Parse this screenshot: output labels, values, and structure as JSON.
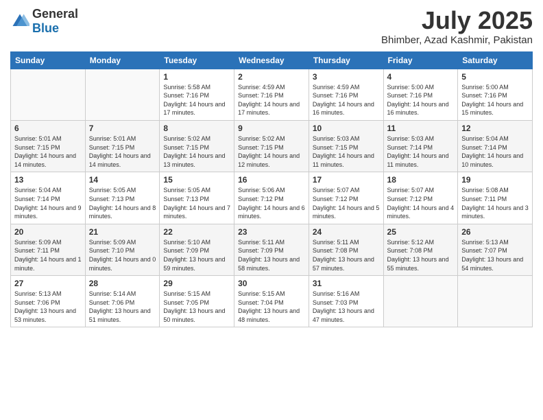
{
  "logo": {
    "general": "General",
    "blue": "Blue"
  },
  "header": {
    "month": "July 2025",
    "location": "Bhimber, Azad Kashmir, Pakistan"
  },
  "weekdays": [
    "Sunday",
    "Monday",
    "Tuesday",
    "Wednesday",
    "Thursday",
    "Friday",
    "Saturday"
  ],
  "weeks": [
    [
      {
        "day": null
      },
      {
        "day": null
      },
      {
        "day": 1,
        "sunrise": "5:58 AM",
        "sunset": "7:16 PM",
        "daylight": "14 hours and 17 minutes."
      },
      {
        "day": 2,
        "sunrise": "4:59 AM",
        "sunset": "7:16 PM",
        "daylight": "14 hours and 17 minutes."
      },
      {
        "day": 3,
        "sunrise": "4:59 AM",
        "sunset": "7:16 PM",
        "daylight": "14 hours and 16 minutes."
      },
      {
        "day": 4,
        "sunrise": "5:00 AM",
        "sunset": "7:16 PM",
        "daylight": "14 hours and 16 minutes."
      },
      {
        "day": 5,
        "sunrise": "5:00 AM",
        "sunset": "7:16 PM",
        "daylight": "14 hours and 15 minutes."
      }
    ],
    [
      {
        "day": 6,
        "sunrise": "5:01 AM",
        "sunset": "7:15 PM",
        "daylight": "14 hours and 14 minutes."
      },
      {
        "day": 7,
        "sunrise": "5:01 AM",
        "sunset": "7:15 PM",
        "daylight": "14 hours and 14 minutes."
      },
      {
        "day": 8,
        "sunrise": "5:02 AM",
        "sunset": "7:15 PM",
        "daylight": "14 hours and 13 minutes."
      },
      {
        "day": 9,
        "sunrise": "5:02 AM",
        "sunset": "7:15 PM",
        "daylight": "14 hours and 12 minutes."
      },
      {
        "day": 10,
        "sunrise": "5:03 AM",
        "sunset": "7:15 PM",
        "daylight": "14 hours and 11 minutes."
      },
      {
        "day": 11,
        "sunrise": "5:03 AM",
        "sunset": "7:14 PM",
        "daylight": "14 hours and 11 minutes."
      },
      {
        "day": 12,
        "sunrise": "5:04 AM",
        "sunset": "7:14 PM",
        "daylight": "14 hours and 10 minutes."
      }
    ],
    [
      {
        "day": 13,
        "sunrise": "5:04 AM",
        "sunset": "7:14 PM",
        "daylight": "14 hours and 9 minutes."
      },
      {
        "day": 14,
        "sunrise": "5:05 AM",
        "sunset": "7:13 PM",
        "daylight": "14 hours and 8 minutes."
      },
      {
        "day": 15,
        "sunrise": "5:05 AM",
        "sunset": "7:13 PM",
        "daylight": "14 hours and 7 minutes."
      },
      {
        "day": 16,
        "sunrise": "5:06 AM",
        "sunset": "7:12 PM",
        "daylight": "14 hours and 6 minutes."
      },
      {
        "day": 17,
        "sunrise": "5:07 AM",
        "sunset": "7:12 PM",
        "daylight": "14 hours and 5 minutes."
      },
      {
        "day": 18,
        "sunrise": "5:07 AM",
        "sunset": "7:12 PM",
        "daylight": "14 hours and 4 minutes."
      },
      {
        "day": 19,
        "sunrise": "5:08 AM",
        "sunset": "7:11 PM",
        "daylight": "14 hours and 3 minutes."
      }
    ],
    [
      {
        "day": 20,
        "sunrise": "5:09 AM",
        "sunset": "7:11 PM",
        "daylight": "14 hours and 1 minute."
      },
      {
        "day": 21,
        "sunrise": "5:09 AM",
        "sunset": "7:10 PM",
        "daylight": "14 hours and 0 minutes."
      },
      {
        "day": 22,
        "sunrise": "5:10 AM",
        "sunset": "7:09 PM",
        "daylight": "13 hours and 59 minutes."
      },
      {
        "day": 23,
        "sunrise": "5:11 AM",
        "sunset": "7:09 PM",
        "daylight": "13 hours and 58 minutes."
      },
      {
        "day": 24,
        "sunrise": "5:11 AM",
        "sunset": "7:08 PM",
        "daylight": "13 hours and 57 minutes."
      },
      {
        "day": 25,
        "sunrise": "5:12 AM",
        "sunset": "7:08 PM",
        "daylight": "13 hours and 55 minutes."
      },
      {
        "day": 26,
        "sunrise": "5:13 AM",
        "sunset": "7:07 PM",
        "daylight": "13 hours and 54 minutes."
      }
    ],
    [
      {
        "day": 27,
        "sunrise": "5:13 AM",
        "sunset": "7:06 PM",
        "daylight": "13 hours and 53 minutes."
      },
      {
        "day": 28,
        "sunrise": "5:14 AM",
        "sunset": "7:06 PM",
        "daylight": "13 hours and 51 minutes."
      },
      {
        "day": 29,
        "sunrise": "5:15 AM",
        "sunset": "7:05 PM",
        "daylight": "13 hours and 50 minutes."
      },
      {
        "day": 30,
        "sunrise": "5:15 AM",
        "sunset": "7:04 PM",
        "daylight": "13 hours and 48 minutes."
      },
      {
        "day": 31,
        "sunrise": "5:16 AM",
        "sunset": "7:03 PM",
        "daylight": "13 hours and 47 minutes."
      },
      {
        "day": null
      },
      {
        "day": null
      }
    ]
  ],
  "labels": {
    "sunrise": "Sunrise:",
    "sunset": "Sunset:",
    "daylight": "Daylight:"
  }
}
